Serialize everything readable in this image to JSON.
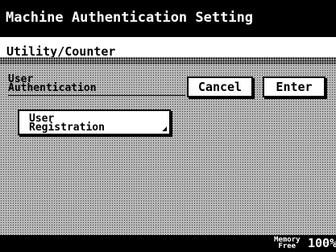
{
  "window": {
    "title": "Machine Authentication Setting"
  },
  "breadcrumb": {
    "text": "Utility/Counter"
  },
  "section": {
    "heading": "User\nAuthentication"
  },
  "actions": {
    "cancel_label": "Cancel",
    "enter_label": "Enter"
  },
  "options": [
    {
      "label": "User\nRegistration"
    }
  ],
  "status": {
    "memory_label": "Memory\nFree",
    "memory_value": "100%"
  }
}
